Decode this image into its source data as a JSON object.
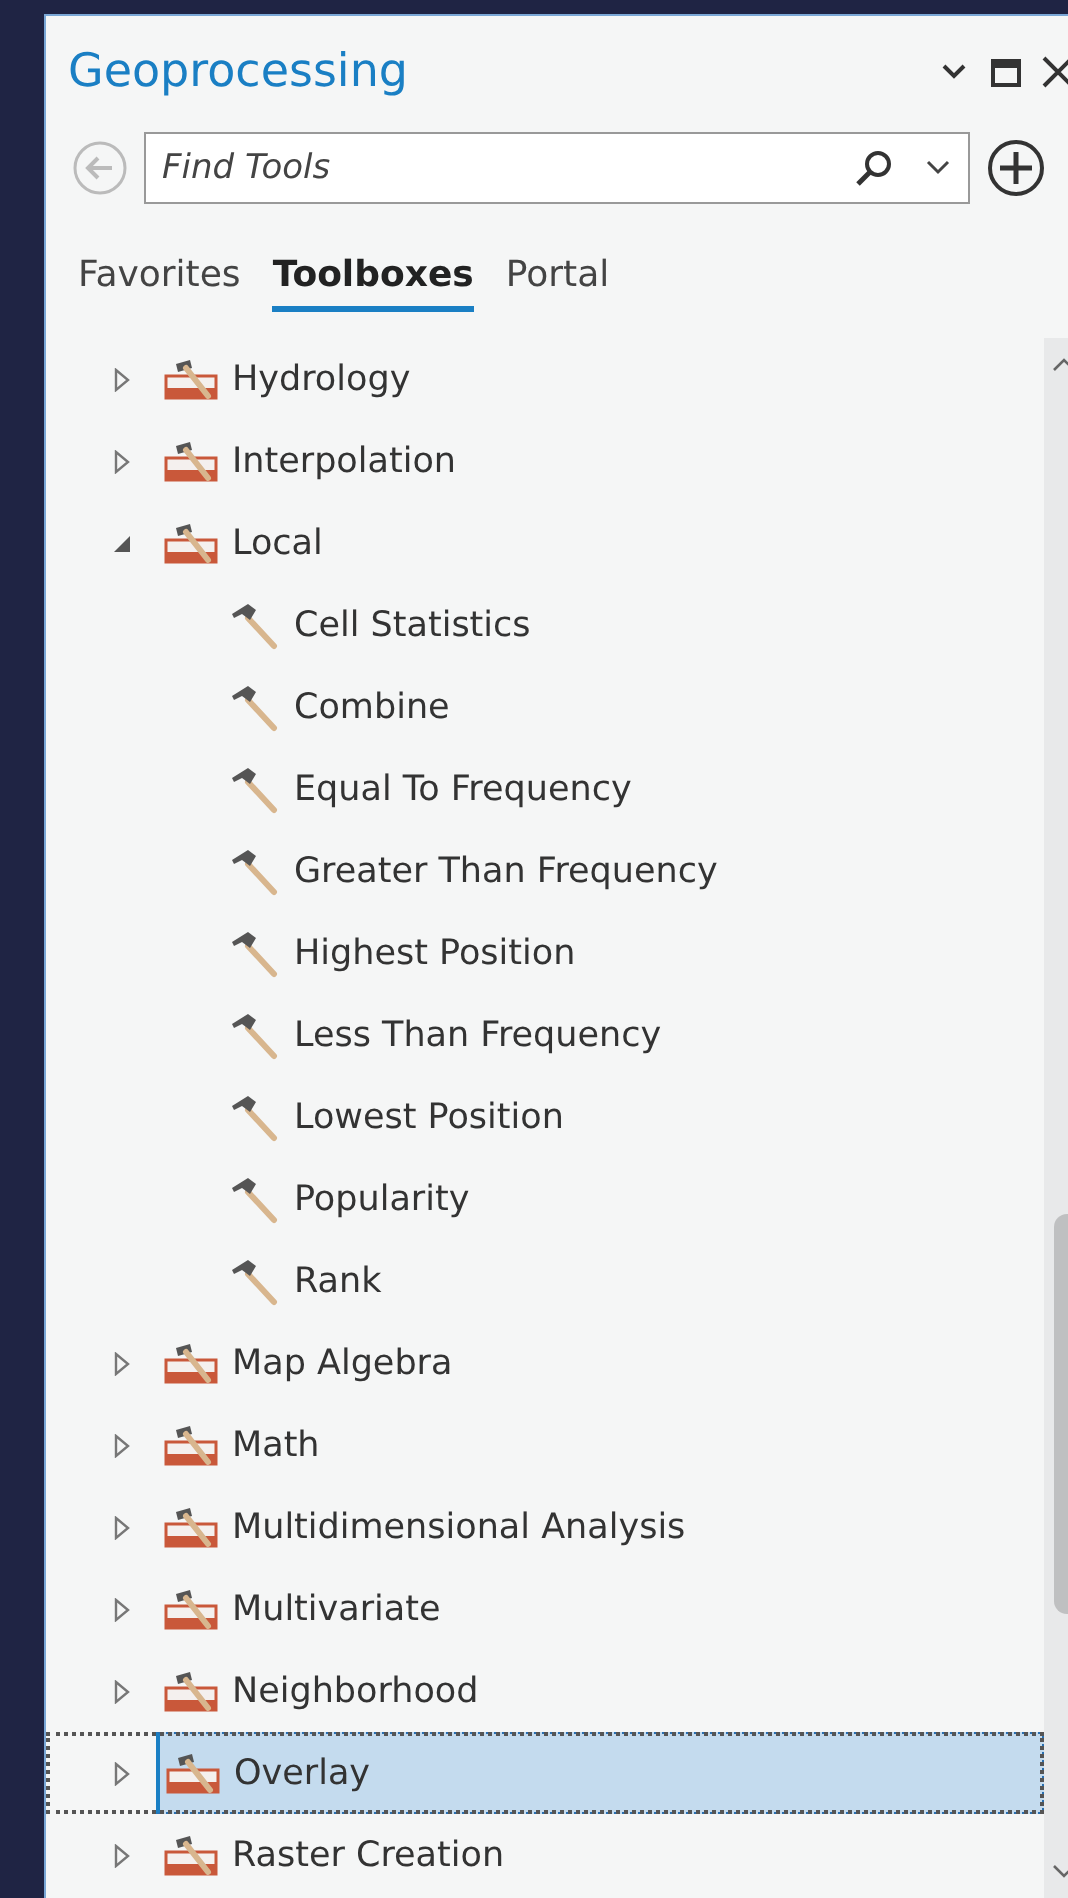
{
  "window": {
    "title": "Geoprocessing"
  },
  "search": {
    "placeholder": "Find Tools"
  },
  "tabs": [
    {
      "label": "Favorites",
      "selected": false
    },
    {
      "label": "Toolboxes",
      "selected": true
    },
    {
      "label": "Portal",
      "selected": false
    }
  ],
  "tree": [
    {
      "label": "Hydrology",
      "expanded": false,
      "selected": false
    },
    {
      "label": "Interpolation",
      "expanded": false,
      "selected": false
    },
    {
      "label": "Local",
      "expanded": true,
      "selected": false,
      "children": [
        {
          "label": "Cell Statistics",
          "selected": false
        },
        {
          "label": "Combine",
          "selected": false
        },
        {
          "label": "Equal To Frequency",
          "selected": false
        },
        {
          "label": "Greater Than Frequency",
          "selected": false
        },
        {
          "label": "Highest Position",
          "selected": false
        },
        {
          "label": "Less Than Frequency",
          "selected": false
        },
        {
          "label": "Lowest Position",
          "selected": false
        },
        {
          "label": "Popularity",
          "selected": false
        },
        {
          "label": "Rank",
          "selected": false
        }
      ]
    },
    {
      "label": "Map Algebra",
      "expanded": false,
      "selected": false
    },
    {
      "label": "Math",
      "expanded": false,
      "selected": false
    },
    {
      "label": "Multidimensional Analysis",
      "expanded": false,
      "selected": false
    },
    {
      "label": "Multivariate",
      "expanded": false,
      "selected": false
    },
    {
      "label": "Neighborhood",
      "expanded": false,
      "selected": false
    },
    {
      "label": "Overlay",
      "expanded": false,
      "selected": true
    },
    {
      "label": "Raster Creation",
      "expanded": false,
      "selected": false
    }
  ]
}
